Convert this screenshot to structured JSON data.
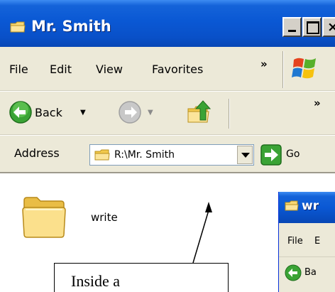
{
  "window": {
    "title": "Mr. Smith",
    "icon": "folder-icon",
    "controls": {
      "minimize": "minimize-icon",
      "maximize": "maximize-icon",
      "close": "×"
    }
  },
  "menubar": {
    "items": [
      "File",
      "Edit",
      "View",
      "Favorites"
    ],
    "overflow": "»"
  },
  "toolbar": {
    "back_label": "Back",
    "dropdown_glyph": "▼",
    "overflow": "»"
  },
  "addressbar": {
    "label": "Address",
    "value": "R:\\Mr. Smith",
    "go_label": "Go"
  },
  "content": {
    "items": [
      {
        "name": "write",
        "icon": "folder-icon"
      }
    ]
  },
  "window2": {
    "title": "wr",
    "menu": [
      "File",
      "E"
    ],
    "back_label": "Ba"
  },
  "callout": {
    "text": "Inside a"
  },
  "colors": {
    "titlebar": "#0a58d4",
    "chrome": "#ece9d8",
    "go_green": "#3aa335",
    "folder_yellow": "#f3d26b"
  }
}
